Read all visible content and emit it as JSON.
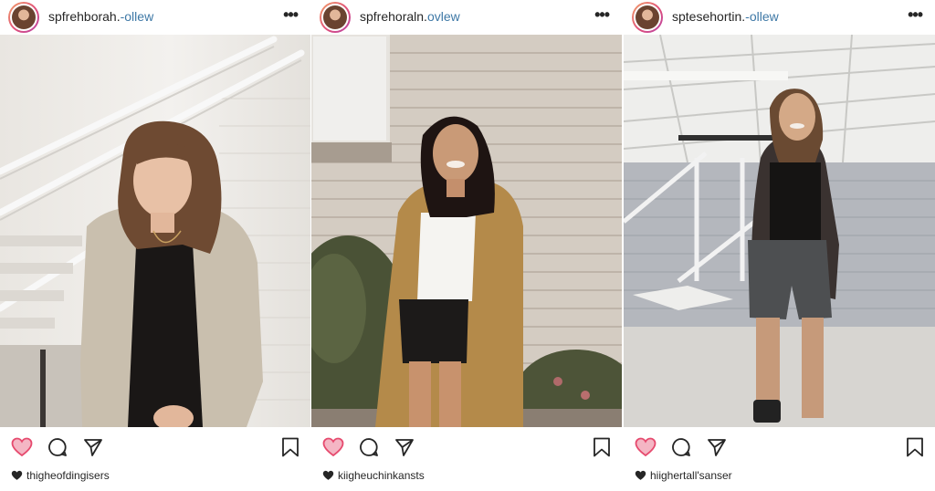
{
  "colors": {
    "like": "#e64a6e",
    "link": "#3e78a6",
    "text": "#262626"
  },
  "icons": [
    "heart-icon",
    "comment-icon",
    "share-icon",
    "bookmark-icon",
    "more-icon"
  ],
  "posts": [
    {
      "username": "spfrehborah.",
      "follow": "-ollew",
      "more": "•••",
      "likes": "thigheofdingisers"
    },
    {
      "username": "spfrehoraln.",
      "follow": "ovlew",
      "more": "•••",
      "likes": "kiigheuchinkansts"
    },
    {
      "username": "sptesehortin.",
      "follow": "-ollew",
      "more": "•••",
      "likes": "hiighertall'sanser"
    }
  ]
}
